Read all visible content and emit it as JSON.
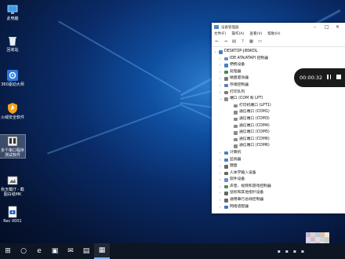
{
  "desktop": {
    "icons": [
      {
        "name": "this-pc",
        "label": "此电脑",
        "glyph": "monitor-icon"
      },
      {
        "name": "recycle-bin",
        "label": "回收站",
        "glyph": "recycle-bin-icon"
      },
      {
        "name": "driver-master",
        "label": "360驱动大师",
        "glyph": "gear-icon"
      },
      {
        "name": "fire-security",
        "label": "火绒安全软件",
        "glyph": "shield-icon"
      },
      {
        "name": "multi-port-tool",
        "label": "多个串口程序测试软件",
        "glyph": "app-icon"
      },
      {
        "name": "screenshot-tool",
        "label": "秋天截IT - 截图白纸MK",
        "glyph": "app-icon"
      },
      {
        "name": "rec-file",
        "label": "Rec 0001",
        "glyph": "video-file-icon"
      }
    ]
  },
  "window": {
    "title": "设备管理器",
    "menu": [
      "文件(F)",
      "操作(A)",
      "查看(V)",
      "帮助(H)"
    ],
    "computer": "DESKTOP-JI89KDL",
    "tree": [
      {
        "label": "IDE ATA/ATAPI 控制器",
        "level": 1,
        "state": "collapsed",
        "color": "#6b8ec9"
      },
      {
        "label": "便携设备",
        "level": 1,
        "state": "collapsed",
        "color": "#4a7fc0"
      },
      {
        "label": "处理器",
        "level": 1,
        "state": "collapsed",
        "color": "#3d8b5a"
      },
      {
        "label": "磁盘驱动器",
        "level": 1,
        "state": "collapsed",
        "color": "#777777"
      },
      {
        "label": "存储控制器",
        "level": 1,
        "state": "collapsed",
        "color": "#5f7fae"
      },
      {
        "label": "打印队列",
        "level": 1,
        "state": "collapsed",
        "color": "#7a7a7a"
      },
      {
        "label": "端口 (COM 和 LPT)",
        "level": 1,
        "state": "expanded",
        "color": "#8a8a8a"
      },
      {
        "label": "打印机端口 (LPT1)",
        "level": 2,
        "state": "none",
        "color": "#8a8a8a"
      },
      {
        "label": "通信端口 (COM1)",
        "level": 2,
        "state": "none",
        "color": "#8a8a8a"
      },
      {
        "label": "通信端口 (COM3)",
        "level": 2,
        "state": "none",
        "color": "#8a8a8a"
      },
      {
        "label": "通信端口 (COM4)",
        "level": 2,
        "state": "none",
        "color": "#8a8a8a"
      },
      {
        "label": "通信端口 (COM5)",
        "level": 2,
        "state": "none",
        "color": "#8a8a8a"
      },
      {
        "label": "通信端口 (COM6)",
        "level": 2,
        "state": "none",
        "color": "#8a8a8a"
      },
      {
        "label": "通信端口 (COM6)",
        "level": 2,
        "state": "none",
        "color": "#8a8a8a"
      },
      {
        "label": "计算机",
        "level": 1,
        "state": "collapsed",
        "color": "#4a7fc0"
      },
      {
        "label": "监视器",
        "level": 1,
        "state": "collapsed",
        "color": "#4a7fc0"
      },
      {
        "label": "键盘",
        "level": 1,
        "state": "collapsed",
        "color": "#666666"
      },
      {
        "label": "人体学输入设备",
        "level": 1,
        "state": "collapsed",
        "color": "#666666"
      },
      {
        "label": "软件设备",
        "level": 1,
        "state": "collapsed",
        "color": "#6b8ec9"
      },
      {
        "label": "声音、视频和游戏控制器",
        "level": 1,
        "state": "collapsed",
        "color": "#5a8a5a"
      },
      {
        "label": "鼠标和其他指针设备",
        "level": 1,
        "state": "collapsed",
        "color": "#666666"
      },
      {
        "label": "通用串行总线控制器",
        "level": 1,
        "state": "collapsed",
        "color": "#666666"
      },
      {
        "label": "网络适配器",
        "level": 1,
        "state": "collapsed",
        "color": "#3a7abf"
      }
    ]
  },
  "recorder": {
    "time": "00:00:32"
  },
  "taskbar": {
    "items": [
      {
        "name": "start-button",
        "glyph": "⊞",
        "active": false
      },
      {
        "name": "search-button",
        "glyph": "○",
        "active": false
      },
      {
        "name": "edge-button",
        "glyph": "e",
        "active": false
      },
      {
        "name": "store-button",
        "glyph": "▣",
        "active": false
      },
      {
        "name": "mail-button",
        "glyph": "✉",
        "active": false
      },
      {
        "name": "app-button",
        "glyph": "▤",
        "active": false
      },
      {
        "name": "device-manager-button",
        "glyph": "▦",
        "active": true
      }
    ]
  },
  "colors": {
    "accent": "#0078d7",
    "taskbar": "#0e1624",
    "recorder": "#1b1b1b"
  }
}
